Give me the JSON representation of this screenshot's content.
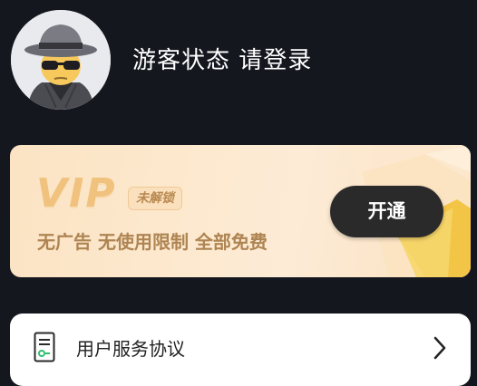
{
  "profile": {
    "avatar_icon": "spy-avatar-icon",
    "login_prompt": "游客状态 请登录"
  },
  "vip_card": {
    "logo_text": "VIP",
    "status_badge": "未解锁",
    "features": "无广告 无使用限制 全部免费",
    "open_button": "开通",
    "colors": {
      "card_start": "#fbe3c3",
      "card_end": "#fdebd6",
      "accent_gold": "#f0c27e",
      "text_brown": "#ae8452",
      "button_bg": "#2b2a2b"
    }
  },
  "menu": {
    "items": [
      {
        "icon": "document-icon",
        "label": "用户服务协议",
        "trailing_icon": "chevron-right-icon"
      }
    ]
  },
  "theme": {
    "page_background": "#15171f"
  }
}
